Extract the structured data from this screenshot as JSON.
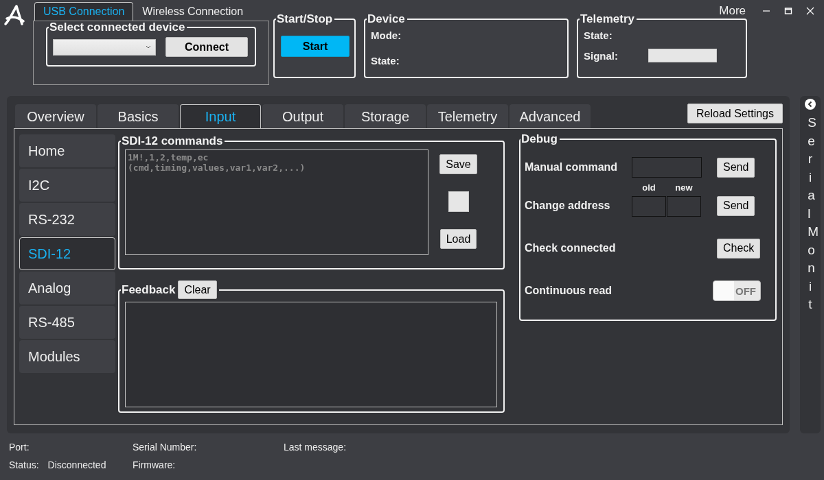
{
  "window": {
    "more": "More"
  },
  "connection_tabs": [
    {
      "label": "USB Connection",
      "selected": true
    },
    {
      "label": "Wireless Connection",
      "selected": false
    }
  ],
  "usb": {
    "group_title": "Select connected device",
    "button": "Connect"
  },
  "start_stop": {
    "title": "Start/Stop",
    "button": "Start"
  },
  "device": {
    "title": "Device",
    "fields": [
      "Mode:",
      "State:"
    ]
  },
  "telemetry": {
    "title": "Telemetry",
    "state_label": "State:",
    "signal_label": "Signal:"
  },
  "tabs": [
    {
      "label": "Overview",
      "selected": false
    },
    {
      "label": "Basics",
      "selected": false
    },
    {
      "label": "Input",
      "selected": true
    },
    {
      "label": "Output",
      "selected": false
    },
    {
      "label": "Storage",
      "selected": false
    },
    {
      "label": "Telemetry",
      "selected": false
    },
    {
      "label": "Advanced",
      "selected": false
    }
  ],
  "reload_button": "Reload Settings",
  "nav": [
    {
      "label": "Home",
      "selected": false
    },
    {
      "label": "I2C",
      "selected": false
    },
    {
      "label": "RS-232",
      "selected": false
    },
    {
      "label": "SDI-12",
      "selected": true
    },
    {
      "label": "Analog",
      "selected": false
    },
    {
      "label": "RS-485",
      "selected": false
    },
    {
      "label": "Modules",
      "selected": false
    }
  ],
  "sdi12": {
    "title": "SDI-12 commands",
    "placeholder": "1M!,1,2,temp,ec\n(cmd,timing,values,var1,var2,...)",
    "save": "Save",
    "load": "Load"
  },
  "feedback": {
    "title": "Feedback",
    "clear": "Clear"
  },
  "debug": {
    "title": "Debug",
    "rows": [
      {
        "kind": "command",
        "label": "Manual command",
        "button": "Send"
      },
      {
        "kind": "address",
        "label": "Change address",
        "old": "old",
        "new": "new",
        "button": "Send"
      },
      {
        "kind": "check",
        "label": "Check connected",
        "button": "Check"
      },
      {
        "kind": "toggle",
        "label": "Continuous read",
        "on": false,
        "state_text": "OFF"
      }
    ]
  },
  "serial_monitor": {
    "label": "Serial Monit"
  },
  "status_bar": {
    "port": "Port:",
    "status_label": "Status:",
    "status": "Disconnected",
    "serial": "Serial Number:",
    "firmware": "Firmware:",
    "last": "Last message:"
  }
}
